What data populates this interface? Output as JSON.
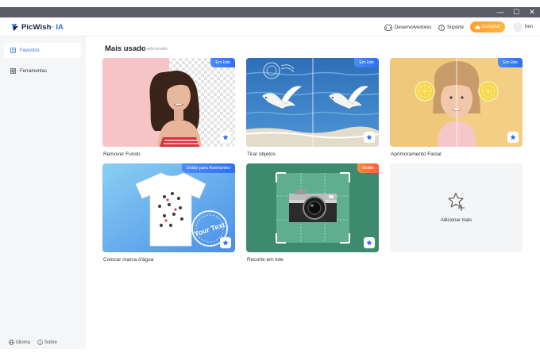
{
  "window": {
    "minimize": "—",
    "maximize": "☐",
    "close": "✕"
  },
  "header": {
    "brand": "PicWish",
    "brand_suffix": "· IA",
    "developers": "Desenvolvedores",
    "support": "Suporte",
    "buy": "Comprar",
    "user": "ben"
  },
  "sidebar": {
    "items": [
      {
        "label": "Favoritos",
        "icon": "favorites-icon",
        "active": true
      },
      {
        "label": "Ferramentas",
        "icon": "tools-icon",
        "active": false
      }
    ],
    "language": "Idioma",
    "about": "Sobre"
  },
  "section": {
    "title": "Mais usado",
    "subtitle": "5 adicionado"
  },
  "cards": [
    {
      "label": "Remover Fundo",
      "tag": "Em lote"
    },
    {
      "label": "Tirar objetos",
      "tag": "Em lote"
    },
    {
      "label": "Aprimoramento Facial",
      "tag": "Em lote"
    },
    {
      "label": "Colocar marca d'água",
      "tag": "Grátis para Assinantes",
      "stamp": "Your Text"
    },
    {
      "label": "Recorte em lote",
      "tag": "Grátis"
    }
  ],
  "add_card": {
    "label": "Adicionar mais"
  },
  "colors": {
    "accent": "#2f6ff2",
    "buy": "#ff9d2e",
    "free_tag": "#ff5f3a"
  }
}
